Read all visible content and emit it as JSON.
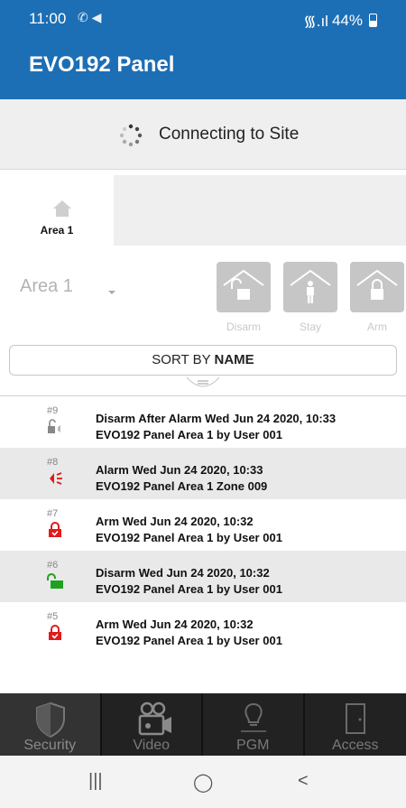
{
  "status_bar": {
    "time": "11:00",
    "left_icons": "✆ ◀",
    "signal_text": "᯾.ıl",
    "battery": "44%"
  },
  "app": {
    "title": "EVO192 Panel"
  },
  "connection": {
    "text": "Connecting to Site"
  },
  "area_tabs": [
    {
      "label": "Area 1",
      "icon": "home-icon"
    }
  ],
  "controls": {
    "area_selected": "Area 1",
    "modes": [
      {
        "label": "Disarm",
        "icon": "unlock-home-icon"
      },
      {
        "label": "Stay",
        "icon": "stay-home-icon"
      },
      {
        "label": "Arm",
        "icon": "lock-home-icon"
      }
    ]
  },
  "sort": {
    "prefix": "SORT BY",
    "field": "NAME"
  },
  "events": [
    {
      "num": "#9",
      "icon": "disarm-after-alarm-icon",
      "line1": "Disarm After Alarm Wed Jun 24 2020, 10:33",
      "line2": "EVO192 Panel Area 1 by User 001"
    },
    {
      "num": "#8",
      "icon": "alarm-siren-icon",
      "line1": "Alarm Wed Jun 24 2020, 10:33",
      "line2": "EVO192 Panel Area 1 Zone 009"
    },
    {
      "num": "#7",
      "icon": "lock-closed-icon",
      "line1": "Arm Wed Jun 24 2020, 10:32",
      "line2": "EVO192 Panel Area 1 by User 001"
    },
    {
      "num": "#6",
      "icon": "lock-open-icon",
      "line1": "Disarm Wed Jun 24 2020, 10:32",
      "line2": "EVO192 Panel Area 1 by User 001"
    },
    {
      "num": "#5",
      "icon": "lock-closed-icon",
      "line1": "Arm Wed Jun 24 2020, 10:32",
      "line2": "EVO192 Panel Area 1 by User 001"
    }
  ],
  "bottom_nav": [
    {
      "label": "Security",
      "icon": "shield-icon",
      "active": true
    },
    {
      "label": "Video",
      "icon": "camera-icon",
      "active": false
    },
    {
      "label": "PGM",
      "icon": "bulb-icon",
      "active": false
    },
    {
      "label": "Access",
      "icon": "door-icon",
      "active": false
    }
  ],
  "system_nav": {
    "recents": "|||",
    "home": "◯",
    "back": "<"
  },
  "colors": {
    "primary": "#1d6fb5",
    "alarm_red": "#e01b1b",
    "disarm_green": "#20a020",
    "nav_bg": "#222222"
  }
}
